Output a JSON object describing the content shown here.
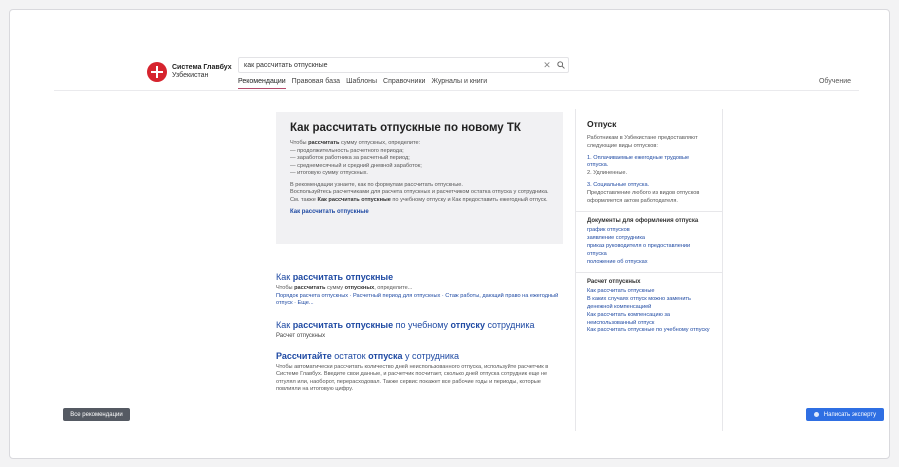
{
  "logo": {
    "name": "Система Главбух",
    "region": "Узбекистан"
  },
  "search": {
    "value": "как рассчитать отпускные",
    "clear_icon": "close-icon",
    "search_icon": "search-icon"
  },
  "tabs": [
    "Рекомендации",
    "Правовая база",
    "Шаблоны",
    "Справочники",
    "Журналы и книги"
  ],
  "training": "Обучение",
  "featured": {
    "title": "Как рассчитать отпускные по новому ТК",
    "intro_pre": "Чтобы ",
    "intro_bold": "рассчитать",
    "intro_post": " сумму отпускных, определите:",
    "list": [
      "продолжительность расчетного периода;",
      "заработок работника за расчетный период;",
      "среднемесячный и средний дневной заработок;",
      "итоговую сумму отпускных."
    ],
    "para_1": "В рекомендации узнаете, как по формулам рассчитать отпускные.",
    "para_2_pre": "Воспользуйтесь расчетчиками для расчета отпускных и ",
    "para_2_mid": "расчетчиком остатка",
    "para_2_post": " отпуска у сотрудника. См. также ",
    "para_2_bold": "Как рассчитать отпускные",
    "para_2_end": " по учебному отпуску и Как предоставить ежегодный отпуск.",
    "link": "Как рассчитать отпускные"
  },
  "results": [
    {
      "title_pre": "Как ",
      "title_bold": "рассчитать отпускные",
      "title_post": "",
      "snippet_pre": "Чтобы ",
      "snippet_b1": "рассчитать",
      "snippet_mid": " сумму ",
      "snippet_b2": "отпускных",
      "snippet_post": ", определите...",
      "links": "Порядок расчета отпускных · Расчетный период для отпускных · Стаж работы, дающий право на ежегодный отпуск · Еще..."
    },
    {
      "title_pre": "Как ",
      "title_bold": "рассчитать отпускные",
      "title_mid": " по учебному ",
      "title_bold2": "отпуску",
      "title_post": " сотрудника",
      "subtitle": "Расчет отпускных"
    },
    {
      "title_bold": "Рассчитайте",
      "title_mid": " остаток ",
      "title_bold2": "отпуска",
      "title_post": " у сотрудника",
      "snippet": "Чтобы автоматически рассчитать количество дней неиспользованного отпуска, используйте расчетчик в Системе Главбух. Введите свои данные, и расчетчик посчитает, сколько дней отпуска сотрудник еще не отгулял или, наоборот, перерасходовал. Также сервис покажет все рабочие годы и периоды, которые повлияли на итоговую цифру."
    }
  ],
  "sidebar": {
    "title": "Отпуск",
    "intro": "Работникам в Узбекистане предоставляют следующие виды отпусков:",
    "items": [
      "1. Оплачиваемые ежегодные трудовые отпуска.",
      "2. Удлиненные.",
      "3. Социальные отпуска."
    ],
    "note": "Предоставление любого из видов отпусков оформляется актом работодателя.",
    "docs_title": "Документы для оформления отпуска",
    "docs": [
      "график отпусков",
      "заявление сотрудника",
      "приказ руководителя о предоставлении отпуска",
      "положение об отпусках"
    ],
    "calc_title": "Расчет отпускных",
    "calc": [
      "Как рассчитать отпускные",
      "В каких случаях отпуск можно заменить денежной компенсацией",
      "Как рассчитать компенсацию за неиспользованный отпуск",
      "Как рассчитать отпускные по учебному отпуску"
    ]
  },
  "buttons": {
    "all_recommendations": "Все рекомендации",
    "ask_expert": "Написать эксперту"
  },
  "colors": {
    "link": "#1f4aa3",
    "brand": "#d6242e",
    "expert_button": "#2f6fe3",
    "active_tab": "#b34a6a"
  }
}
